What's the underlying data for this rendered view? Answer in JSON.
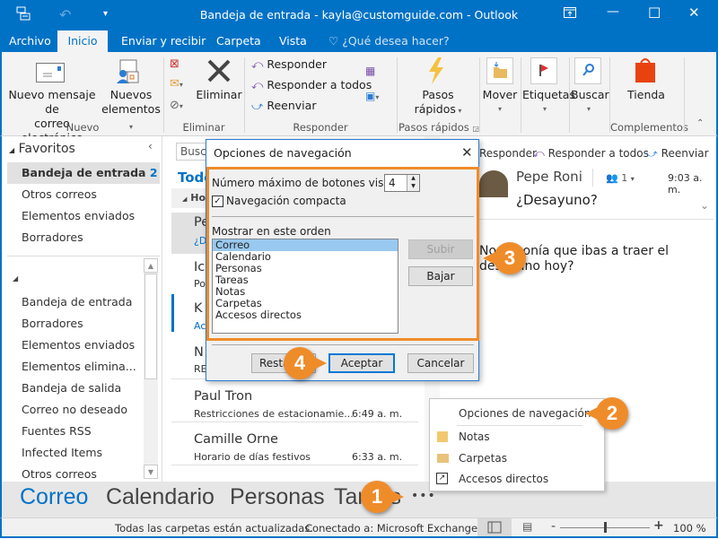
{
  "window": {
    "title": "Bandeja de entrada - kayla@customguide.com - Outlook",
    "quick_access": {
      "app_icon": "outlook-send-receive-icon",
      "undo_icon": "undo-icon",
      "customize_icon": "customize-qat-icon"
    },
    "controls": {
      "restore_ribbon": "ribbon-display-icon",
      "minimize": "—",
      "maximize": "☐",
      "close": "✕"
    }
  },
  "ribbon_tabs": [
    {
      "label": "Archivo",
      "active": false
    },
    {
      "label": "Inicio",
      "active": true
    },
    {
      "label": "Enviar y recibir",
      "active": false
    },
    {
      "label": "Carpeta",
      "active": false
    },
    {
      "label": "Vista",
      "active": false
    }
  ],
  "tell_me": {
    "icon": "lightbulb-icon",
    "placeholder": "¿Qué desea hacer?"
  },
  "ribbon": {
    "groups": {
      "nuevo": {
        "label": "Nuevo",
        "new_email": {
          "line1": "Nuevo mensaje de",
          "line2": "correo electrónico"
        },
        "new_items": {
          "line1": "Nuevos",
          "line2": "elementos"
        }
      },
      "eliminar": {
        "label": "Eliminar",
        "delete": "Eliminar"
      },
      "responder": {
        "label": "Responder",
        "reply": "Responder",
        "reply_all": "Responder a todos",
        "forward": "Reenviar"
      },
      "pasos": {
        "label": "Pasos rápidos",
        "quick_steps": {
          "line1": "Pasos",
          "line2": "rápidos"
        }
      },
      "move": "Mover",
      "tags": "Etiquetas",
      "find": "Buscar",
      "complementos": {
        "label": "Complementos",
        "store": "Tienda"
      }
    }
  },
  "nav_pane": {
    "favorites_header": "Favoritos",
    "favorites": [
      {
        "label": "Bandeja de entrada",
        "count": "2",
        "selected": true
      },
      {
        "label": "Otros correos"
      },
      {
        "label": "Elementos enviados"
      },
      {
        "label": "Borradores"
      }
    ],
    "folders": [
      "Bandeja de entrada",
      "Borradores",
      "Elementos enviados",
      "Elementos elimina...",
      "Bandeja de salida",
      "Correo no deseado",
      "Fuentes RSS",
      "Infected Items",
      "Otros correos"
    ]
  },
  "message_list": {
    "search_placeholder": "Busca",
    "filter_label": "Todo",
    "group_header": "Ho",
    "messages": [
      {
        "sender": "Pe",
        "subject": "¿D",
        "time": ""
      },
      {
        "sender": "Ic",
        "subject": "Po",
        "time": ""
      },
      {
        "sender": "K",
        "subject": "Ac",
        "time": ""
      },
      {
        "sender": "N",
        "subject": "RE",
        "time": ""
      },
      {
        "sender": "Paul Tron",
        "subject": "Restricciones de estacionamie...",
        "time": "6:49 a. m."
      },
      {
        "sender": "Camille Orne",
        "subject": "Horario de días festivos",
        "time": "6:33 a. m."
      }
    ]
  },
  "reading_pane": {
    "actions": {
      "reply": "Responder",
      "reply_all": "Responder a todos",
      "forward": "Reenviar"
    },
    "from": "Pepe Roni",
    "people_count": "1",
    "time": "9:03 a. m.",
    "subject": "¿Desayuno?",
    "body_line1": "No suponía que ibas a traer el",
    "body_line2": "desayuno hoy?"
  },
  "dialog": {
    "title": "Opciones de navegación",
    "max_buttons_label": "Número máximo de botones visibles:",
    "max_buttons_value": "4",
    "compact_nav_label": "Navegación compacta",
    "compact_nav_checked": true,
    "order_label": "Mostrar en este orden",
    "order_items": [
      "Correo",
      "Calendario",
      "Personas",
      "Tareas",
      "Notas",
      "Carpetas",
      "Accesos directos"
    ],
    "selected_item": "Correo",
    "move_up": "Subir",
    "move_down": "Bajar",
    "reset": "Restablecer",
    "ok": "Aceptar",
    "cancel": "Cancelar"
  },
  "context_menu": {
    "items": [
      {
        "label": "Opciones de navegación...",
        "icon": ""
      },
      {
        "label": "Notas",
        "icon": "notes-icon"
      },
      {
        "label": "Carpetas",
        "icon": "folder-icon"
      },
      {
        "label": "Accesos directos",
        "icon": "shortcut-icon"
      }
    ]
  },
  "nav_bar": {
    "items": [
      {
        "label": "Correo",
        "active": true
      },
      {
        "label": "Calendario"
      },
      {
        "label": "Personas"
      },
      {
        "label": "Tareas"
      }
    ],
    "more": "•••"
  },
  "status_bar": {
    "sync": "Todas las carpetas están actualizadas.",
    "connection": "Conectado a: Microsoft Exchange",
    "zoom_percent": "100 %",
    "zoom_value": 100
  },
  "callouts": [
    "1",
    "2",
    "3",
    "4"
  ],
  "colors": {
    "accent": "#0072c6",
    "callout": "#ef8c2a",
    "selection": "#99c9ef"
  }
}
